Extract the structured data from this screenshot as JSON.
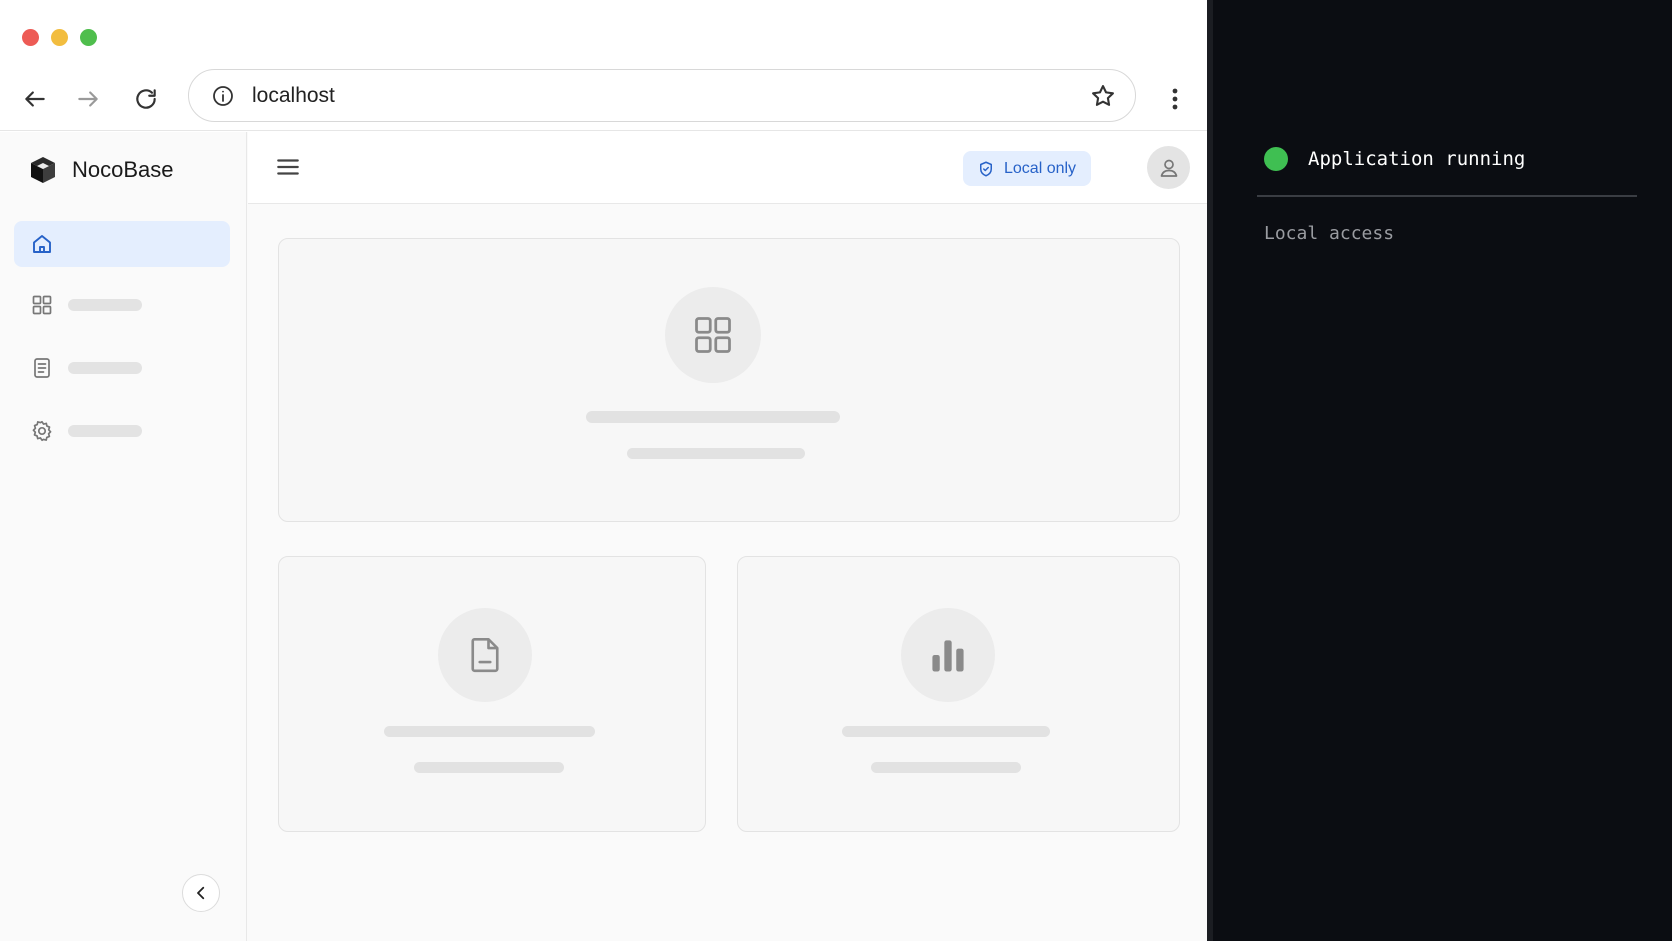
{
  "browser": {
    "url": "localhost",
    "icons": [
      "back-icon",
      "forward-icon",
      "reload-icon",
      "info-icon",
      "star-icon",
      "more-vertical-icon"
    ]
  },
  "app": {
    "brand": "NocoBase",
    "badge": "Local only",
    "sidebar_icons": [
      "home-icon",
      "grid-icon",
      "document-icon",
      "settings-icon"
    ]
  },
  "terminal": {
    "status": "Application running",
    "subtitle": "Local access",
    "status_color": "#3fbf52"
  },
  "colors": {
    "accent": "#2762c8",
    "accent_bg": "#e4eefe",
    "terminal_bg": "#0b0d12"
  }
}
